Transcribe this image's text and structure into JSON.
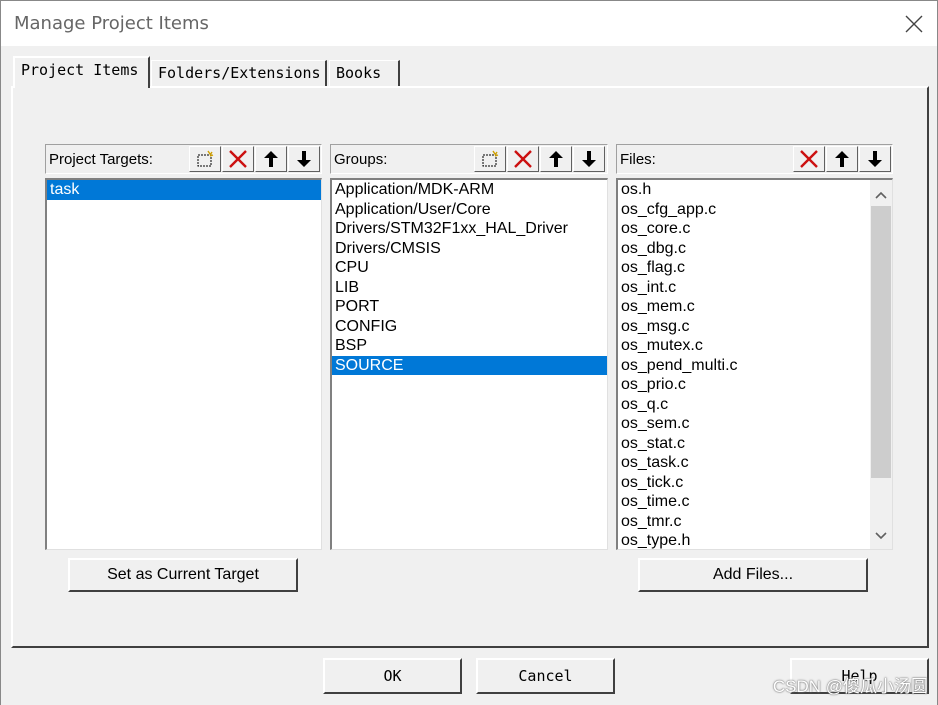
{
  "window": {
    "title": "Manage Project Items"
  },
  "tabs": [
    {
      "label": "Project Items"
    },
    {
      "label": "Folders/Extensions"
    },
    {
      "label": "Books"
    }
  ],
  "targets": {
    "label": "Project Targets:",
    "items": [
      "task"
    ],
    "selected": "task"
  },
  "groups": {
    "label": "Groups:",
    "items": [
      "Application/MDK-ARM",
      "Application/User/Core",
      "Drivers/STM32F1xx_HAL_Driver",
      "Drivers/CMSIS",
      "CPU",
      "LIB",
      "PORT",
      "CONFIG",
      "BSP",
      "SOURCE"
    ],
    "selected": "SOURCE"
  },
  "files": {
    "label": "Files:",
    "items": [
      "os.h",
      "os_cfg_app.c",
      "os_core.c",
      "os_dbg.c",
      "os_flag.c",
      "os_int.c",
      "os_mem.c",
      "os_msg.c",
      "os_mutex.c",
      "os_pend_multi.c",
      "os_prio.c",
      "os_q.c",
      "os_sem.c",
      "os_stat.c",
      "os_task.c",
      "os_tick.c",
      "os_time.c",
      "os_tmr.c",
      "os_type.h"
    ]
  },
  "buttons": {
    "set_target": "Set as Current Target",
    "add_files": "Add Files...",
    "ok": "OK",
    "cancel": "Cancel",
    "help": "Help"
  },
  "watermark": "CSDN @傻瓜小汤圆",
  "colors": {
    "selection": "#0078d7",
    "delete_red": "#cc1010"
  }
}
